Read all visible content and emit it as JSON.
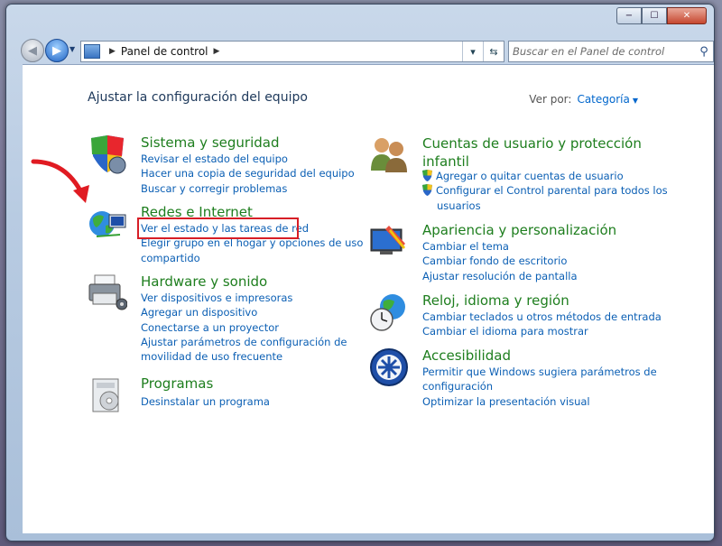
{
  "window": {
    "minimize_label": "−",
    "maximize_label": "☐",
    "close_label": "✕"
  },
  "nav": {
    "address": "Panel de control",
    "search_placeholder": "Buscar en el Panel de control"
  },
  "header": {
    "title": "Ajustar la configuración del equipo",
    "view_by_label": "Ver por:",
    "view_by_value": "Categoría"
  },
  "categories_left": [
    {
      "title": "Sistema y seguridad",
      "icon": "shield-computer-icon",
      "links": [
        "Revisar el estado del equipo",
        "Hacer una copia de seguridad del equipo",
        "Buscar y corregir problemas"
      ]
    },
    {
      "title": "Redes e Internet",
      "icon": "network-globe-icon",
      "links": [
        "Ver el estado y las tareas de red",
        "Elegir grupo en el hogar y opciones de uso",
        "compartido"
      ]
    },
    {
      "title": "Hardware y sonido",
      "icon": "printer-icon",
      "links": [
        "Ver dispositivos e impresoras",
        "Agregar un dispositivo",
        "Conectarse a un proyector",
        "Ajustar parámetros de configuración de",
        "movilidad de uso frecuente"
      ]
    },
    {
      "title": "Programas",
      "icon": "programs-box-icon",
      "links": [
        "Desinstalar un programa"
      ]
    }
  ],
  "categories_right": [
    {
      "title_line1": "Cuentas de usuario y protección",
      "title_line2": "infantil",
      "icon": "users-icon",
      "links": [
        "Agregar o quitar cuentas de usuario",
        "Configurar el Control parental para todos los",
        "usuarios"
      ]
    },
    {
      "title": "Apariencia y personalización",
      "icon": "monitor-paint-icon",
      "links": [
        "Cambiar el tema",
        "Cambiar fondo de escritorio",
        "Ajustar resolución de pantalla"
      ]
    },
    {
      "title": "Reloj, idioma y región",
      "icon": "clock-globe-icon",
      "links": [
        "Cambiar teclados u otros métodos de entrada",
        "Cambiar el idioma para mostrar"
      ]
    },
    {
      "title": "Accesibilidad",
      "icon": "accessibility-icon",
      "links": [
        "Permitir que Windows sugiera parámetros de",
        "configuración",
        "Optimizar la presentación visual"
      ]
    }
  ],
  "colors": {
    "category_title": "#1e7e1e",
    "link": "#0b5fb4",
    "highlight_box": "#d71e26",
    "annotation_arrow": "#e01b22"
  }
}
